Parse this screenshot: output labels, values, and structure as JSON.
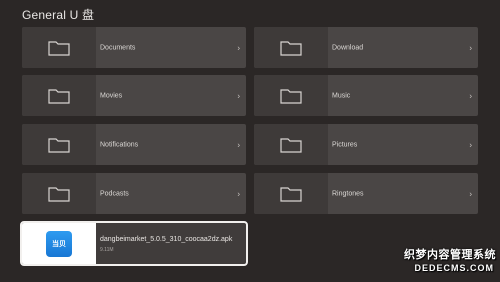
{
  "header": {
    "title": "General U 盘"
  },
  "folders": [
    {
      "label": "Documents"
    },
    {
      "label": "Download"
    },
    {
      "label": "Movies"
    },
    {
      "label": "Music"
    },
    {
      "label": "Notifications"
    },
    {
      "label": "Pictures"
    },
    {
      "label": "Podcasts"
    },
    {
      "label": "Ringtones"
    }
  ],
  "file": {
    "name": "dangbeimarket_5.0.5_310_coocaa2dz.apk",
    "size": "9.11M",
    "icon_text": "当贝"
  },
  "chevron": "›",
  "watermark": {
    "line1": "织梦内容管理系统",
    "line2": "DEDECMS.COM"
  }
}
